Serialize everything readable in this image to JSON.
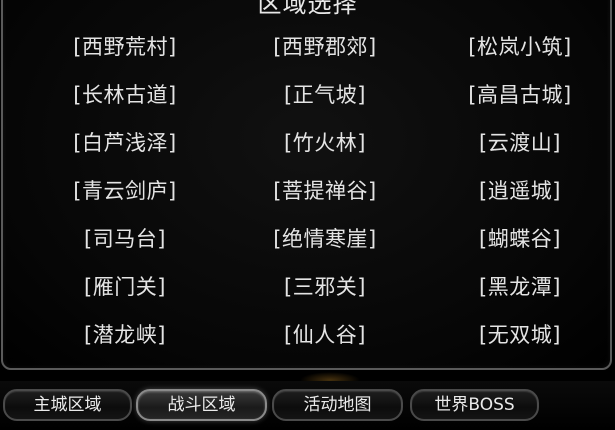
{
  "panel": {
    "title": "区域选择"
  },
  "regions": [
    "[西野荒村]",
    "[西野郡郊]",
    "[松岚小筑]",
    "[长林古道]",
    "[正气坡]",
    "[高昌古城]",
    "[白芦浅泽]",
    "[竹火林]",
    "[云渡山]",
    "[青云剑庐]",
    "[菩提禅谷]",
    "[逍遥城]",
    "[司马台]",
    "[绝情寒崖]",
    "[蝴蝶谷]",
    "[雁门关]",
    "[三邪关]",
    "[黑龙潭]",
    "[潜龙峡]",
    "[仙人谷]",
    "[无双城]"
  ],
  "tabs": [
    {
      "label": "主城区域",
      "active": false
    },
    {
      "label": "战斗区域",
      "active": true
    },
    {
      "label": "活动地图",
      "active": false
    },
    {
      "label": "世界BOSS",
      "active": false
    }
  ],
  "colors": {
    "text": "#e4e4e4",
    "panel_border": "#5a5a5a",
    "background": "#000000"
  }
}
